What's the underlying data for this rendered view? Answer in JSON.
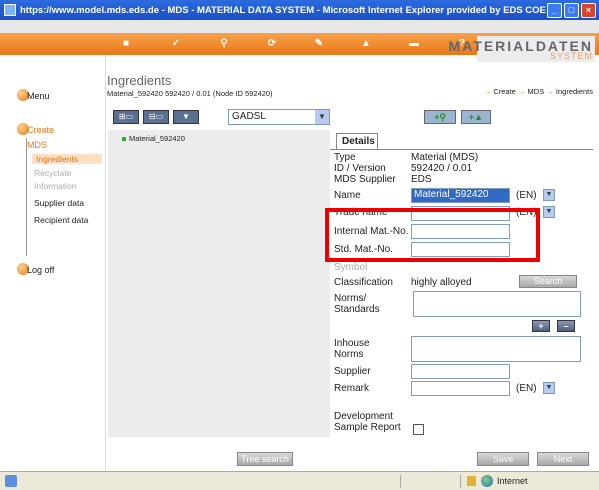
{
  "window": {
    "title": "https://www.model.mds.eds.de - MDS - MATERIAL DATA SYSTEM - Microsoft Internet Explorer provided by EDS COE"
  },
  "brand": {
    "line1": "MATERIALDATEN",
    "line2": "SYSTEM"
  },
  "nav_icons": [
    "home-icon",
    "check-icon",
    "search-icon",
    "refresh-icon",
    "pen-icon",
    "alert-icon",
    "print-icon",
    "help-icon"
  ],
  "sidebar": {
    "menu": "Menu",
    "create": "Create",
    "mds": "MDS",
    "items": [
      {
        "label": "Ingredients",
        "state": "active"
      },
      {
        "label": "Recyclate",
        "state": "disabled"
      },
      {
        "label": "Information",
        "state": "disabled"
      },
      {
        "label": "Supplier data",
        "state": "normal"
      },
      {
        "label": "Recipient data",
        "state": "normal"
      }
    ],
    "logoff": "Log off"
  },
  "header": {
    "title": "Ingredients",
    "subtitle": "Material_592420 592420 / 0.01 (Node ID 592420)",
    "breadcrumbs": [
      "Create",
      "MDS",
      "Ingredients"
    ]
  },
  "toolbar": {
    "gadsl": "GADSL"
  },
  "tree": {
    "root": "Material_592420"
  },
  "details": {
    "tab": "Details",
    "type_label": "Type",
    "type_value": "Material (MDS)",
    "id_label": "ID / Version",
    "id_value": "592420 / 0.01",
    "supplier_label": "MDS Supplier",
    "supplier_value": "EDS",
    "name_label": "Name",
    "name_value": "Material_592420",
    "lang": "(EN)",
    "trade_label": "Trade name",
    "internal_label": "Internal Mat.-No.",
    "std_label": "Std. Mat.-No.",
    "symbol_label": "Symbol",
    "classification_label": "Classification",
    "classification_value": "highly alloyed",
    "search_button": "Search",
    "norms_label": "Norms/\nStandards",
    "inhouse_label": "Inhouse\nNorms",
    "supplier2_label": "Supplier",
    "remark_label": "Remark",
    "dev_label": "Development\nSample Report",
    "plus": "+",
    "minus": "–"
  },
  "buttons": {
    "tree_search": "Tree search",
    "save": "Save",
    "next": "Next"
  },
  "statusbar": {
    "zone": "Internet"
  },
  "colors": {
    "accent": "#e87818",
    "highlight": "#ee0000",
    "titlebar": "#1a4fc4"
  }
}
